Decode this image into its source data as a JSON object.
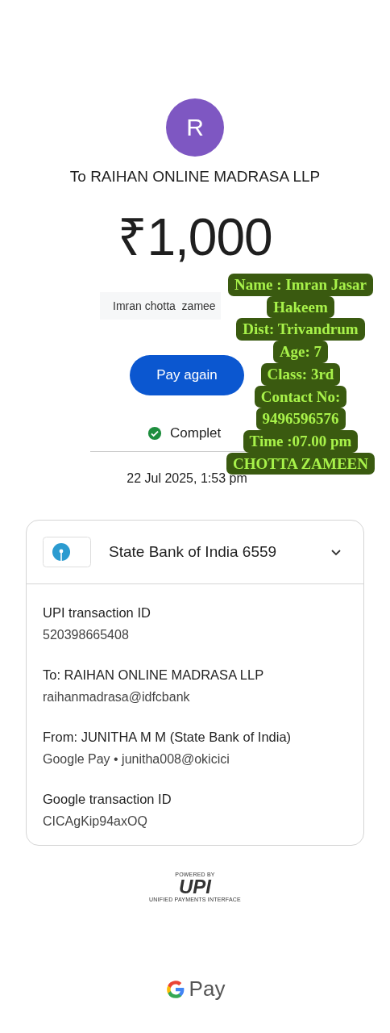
{
  "payee": {
    "initial": "R",
    "title": "To RAIHAN ONLINE MADRASA LLP"
  },
  "amount": "₹1,000",
  "note": "Imran chotta  zamee",
  "pay_again_button": "Pay again",
  "status": {
    "label": "Complet"
  },
  "date": "22 Jul 2025, 1:53 pm",
  "details": {
    "account": "State Bank of India 6559",
    "expanded": true,
    "rows": [
      {
        "label": "UPI transaction ID",
        "value": "520398665408"
      },
      {
        "label": "To: RAIHAN ONLINE MADRASA LLP",
        "value": "raihanmadrasa@idfcbank"
      },
      {
        "label": "From: JUNITHA  M M (State Bank of India)",
        "value": "Google Pay • junitha008@okicici"
      },
      {
        "label": "Google transaction ID",
        "value": "CICAgKip94axOQ"
      }
    ]
  },
  "upi_logo": {
    "top": "POWERED BY",
    "mark": "UPI",
    "bottom": "UNIFIED PAYMENTS INTERFACE"
  },
  "footer_brand": "Pay",
  "sticker_lines": [
    "Name : Imran Jasar",
    "Hakeem",
    "Dist: Trivandrum",
    "Age: 7",
    "Class: 3rd",
    "Contact No:",
    "9496596576",
    "Time :07.00 pm",
    "CHOTTA ZAMEEN"
  ]
}
